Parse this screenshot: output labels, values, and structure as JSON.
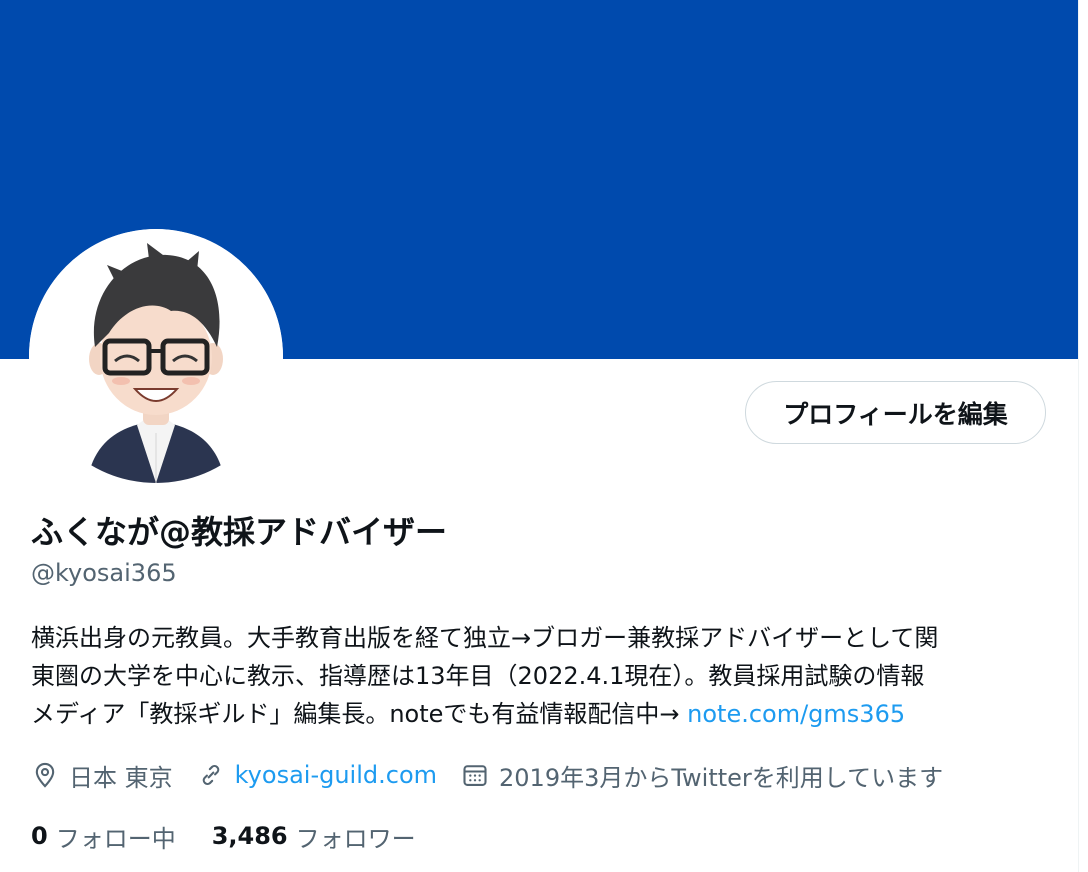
{
  "profile": {
    "display_name": "ふくなが@教採アドバイザー",
    "handle": "@kyosai365",
    "edit_button_label": "プロフィールを編集",
    "bio": {
      "line1": "横浜出身の元教員。大手教育出版を経て独立→ブロガー兼教採アドバイザーとして関",
      "line2": "東圏の大学を中心に教示、指導歴は13年目（2022.4.1現在）。教員採用試験の情報",
      "line3_text": "メディア「教採ギルド」編集長。noteでも有益情報配信中→ ",
      "line3_link": "note.com/gms365"
    },
    "location": "日本 東京",
    "website": "kyosai-guild.com",
    "joined": "2019年3月からTwitterを利用しています",
    "following_count": "0",
    "following_label": "フォロー中",
    "followers_count": "3,486",
    "followers_label": "フォロワー"
  },
  "colors": {
    "banner": "#004aad",
    "link": "#1d9bf0",
    "secondary_text": "#536471",
    "primary_text": "#0f1419"
  },
  "icons": {
    "location": "location-pin-icon",
    "website": "link-icon",
    "joined": "calendar-icon"
  }
}
